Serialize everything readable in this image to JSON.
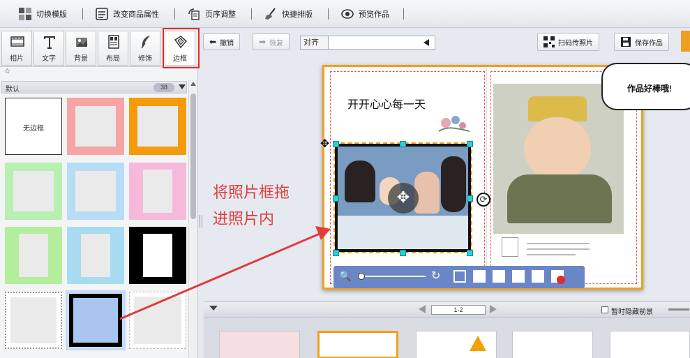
{
  "toolbar": {
    "switch_template": "切换模版",
    "change_product": "改变商品属性",
    "page_order": "页序调整",
    "quick_layout": "快捷排版",
    "preview": "预览作品"
  },
  "tabs": [
    {
      "label": "相片",
      "icon": "filmstrip-icon"
    },
    {
      "label": "文字",
      "icon": "text-t-icon"
    },
    {
      "label": "背景",
      "icon": "background-icon"
    },
    {
      "label": "布局",
      "icon": "layout-icon"
    },
    {
      "label": "修饰",
      "icon": "feather-icon"
    },
    {
      "label": "边框",
      "icon": "frame-icon",
      "active": true
    }
  ],
  "favorites_star": "☆",
  "category": {
    "name": "默认",
    "count": "38"
  },
  "frames": {
    "none_label": "无边框"
  },
  "editbar": {
    "undo": "撤销",
    "redo": "恢复",
    "align_value": "对齐",
    "scan_upload": "扫码传照片",
    "save": "保存作品"
  },
  "page": {
    "title": "开开心心每一天",
    "bubble": "作品好棒哦!"
  },
  "annotation": {
    "line1": "将照片框拖",
    "line2": "进照片内"
  },
  "strip": {
    "pager": "1-2",
    "hide_foreground": "暂时隐藏前景"
  },
  "colors": {
    "accent": "#f0a020",
    "annotation_red": "#e03c3c",
    "highlight_red": "#e02b2b",
    "zoombar_blue": "#6b86c6"
  }
}
